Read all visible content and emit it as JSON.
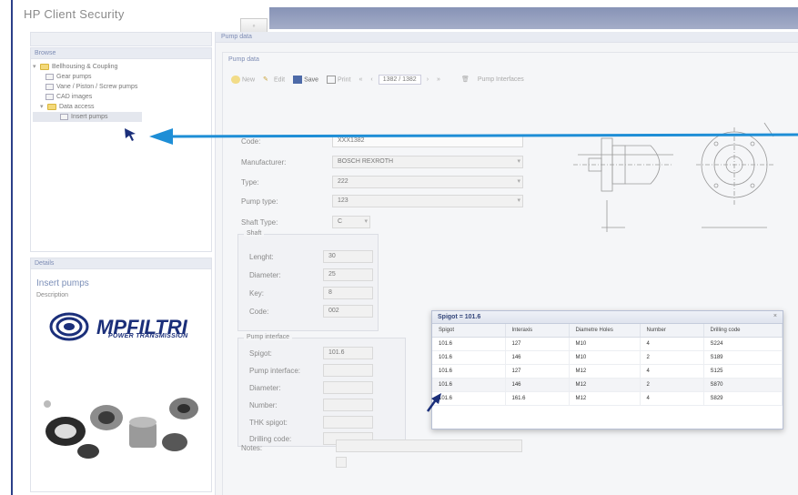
{
  "app": {
    "title": "HP Client Security",
    "titlebar_btn": "◦"
  },
  "browse": {
    "header": "Browse",
    "tree": [
      {
        "label": "Bellhousing & Coupling",
        "level": 0,
        "type": "folder"
      },
      {
        "label": "Gear pumps",
        "level": 1,
        "type": "doc"
      },
      {
        "label": "Vane / Piston / Screw pumps",
        "level": 1,
        "type": "doc"
      },
      {
        "label": "CAD images",
        "level": 1,
        "type": "doc"
      },
      {
        "label": "Data access",
        "level": 1,
        "type": "folder"
      },
      {
        "label": "Insert pumps",
        "level": 2,
        "type": "doc",
        "selected": true
      }
    ]
  },
  "details": {
    "header": "Details",
    "title": "Insert pumps",
    "desc_label": "Description",
    "logo_text": "MPFILTRI",
    "logo_sub": "POWER TRANSMISSION"
  },
  "main": {
    "header": "Pump data",
    "form_header": "Pump data",
    "toolbar": {
      "new": "New",
      "edit": "Edit",
      "save": "Save",
      "print": "Print",
      "pager": "1382 / 1382",
      "extra": "Pump Interfaces"
    },
    "fields": {
      "code_label": "Code:",
      "code_value": "XXX1382",
      "manufacturer_label": "Manufacturer:",
      "manufacturer_value": "BOSCH REXROTH",
      "type_label": "Type:",
      "type_value": "222",
      "pump_type_label": "Pump type:",
      "pump_type_value": "123",
      "shaft_type_label": "Shaft Type:",
      "shaft_type_value": "C"
    },
    "shaft": {
      "legend": "Shaft",
      "length_label": "Lenght:",
      "length_value": "30",
      "diameter_label": "Diameter:",
      "diameter_value": "25",
      "key_label": "Key:",
      "key_value": "8",
      "code_label": "Code:",
      "code_value": "002"
    },
    "interface": {
      "legend": "Pump interface",
      "spigot_label": "Spigot:",
      "spigot_value": "101.6",
      "pump_interface_label": "Pump interface:",
      "diameter_label": "Diameter:",
      "number_label": "Number:",
      "thk_label": "THK spigot:",
      "drilling_label": "Drilling code:"
    },
    "notes_label": "Notes:"
  },
  "popup": {
    "title": "Spigot = 101.6",
    "close": "×",
    "columns": [
      "Spigot",
      "Interaxis",
      "Diametre Holes",
      "Number",
      "Drilling code"
    ],
    "rows": [
      [
        "101.6",
        "127",
        "M10",
        "4",
        "S224"
      ],
      [
        "101.6",
        "146",
        "M10",
        "2",
        "S189"
      ],
      [
        "101.6",
        "127",
        "M12",
        "4",
        "S125"
      ],
      [
        "101.6",
        "146",
        "M12",
        "2",
        "S870"
      ],
      [
        "101.6",
        "161.6",
        "M12",
        "4",
        "S829"
      ]
    ]
  },
  "colors": {
    "accent_arrow": "#1e8ed6",
    "header_text": "#7d8cb4",
    "frame_border": "#2b3f88"
  }
}
